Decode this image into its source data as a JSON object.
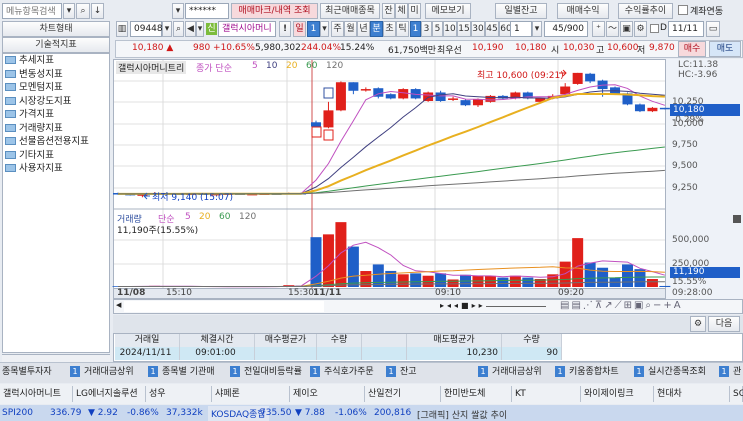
{
  "left": {
    "search_placeholder": "메뉴항목검색",
    "chart_type": "차트형태",
    "tech_indicators": "기술적지표",
    "tree": [
      "추세지표",
      "변동성지표",
      "모멘텀지표",
      "시장강도지표",
      "가격지표",
      "거래량지표",
      "선물옵션전용지표",
      "기타지표",
      "사용자지표"
    ]
  },
  "top": {
    "password": "******",
    "trade_mark_btn": "매매마크/내역 조회",
    "recent_btn": "최근매매종목",
    "jan": "잔",
    "che": "체",
    "mi": "미",
    "memo": "메모보기",
    "daily_balance": "일별잔고",
    "trade_profit": "매매수익",
    "return_trend": "수익률추이",
    "account_link": "계좌연동"
  },
  "chart_toolbar": {
    "code": "094480",
    "new_badge": "신",
    "name": "갤럭시아머니",
    "excl": "!",
    "day": "일",
    "day_n": "1",
    "week": "주",
    "month": "월",
    "year": "년",
    "minute": "분",
    "second": "초",
    "tick": "틱",
    "intervals": [
      "1",
      "3",
      "5",
      "10",
      "15",
      "30",
      "45",
      "60"
    ],
    "custom": "1",
    "count": "45/900",
    "d_label": "D",
    "date": "11/11"
  },
  "quote": {
    "price": "10,180 ▲",
    "change": "980 +10.65%",
    "volume": "5,980,302",
    "vol_ratio": "244.04%",
    "turnover": "15.24%",
    "amount": "61,750백만",
    "best_label": "최우선",
    "ask": "10,190",
    "bid": "10,180",
    "open_label": "시",
    "open": "10,030",
    "high_label": "고",
    "high": "10,600",
    "low_label": "저",
    "low": "9,870",
    "buy": "매수",
    "sell": "매도"
  },
  "colors": {
    "up": "#e0201a",
    "down": "#1f5fc8",
    "ma5": "#c050c0",
    "ma10": "#404080",
    "ma20": "#e8b020",
    "ma60": "#3a9a50",
    "ma120": "#707070"
  },
  "chart_data": {
    "type": "candlestick",
    "legend": {
      "name": "갤럭시아머니트리",
      "label": "종가 단순",
      "periods": [
        "5",
        "10",
        "20",
        "60",
        "120"
      ]
    },
    "vol_legend": {
      "label": "거래량",
      "sub": "단순",
      "periods": [
        "5",
        "20",
        "60",
        "120"
      ],
      "info": "11,190주(15.55%)"
    },
    "high_annot": "최고 10,600 (09:21)",
    "low_annot": "최저 9,140 (15:07)",
    "y_ticks": [
      "10,500",
      "10,250",
      "10,000",
      "9,750",
      "9,500",
      "9,250"
    ],
    "vol_ticks": [
      "500,000",
      "250,000"
    ],
    "lc": "LC:11.38",
    "hc": "HC:-3.96",
    "last": "10,180",
    "last_pct": "-0.29%",
    "vol_last": "11,190",
    "vol_pct": "15.55%",
    "x_labels": [
      "11/08",
      "15:10",
      "15:30",
      "11/11",
      "09:10",
      "09:20"
    ],
    "x_end": "09:28:00",
    "prev_close": 9180,
    "pre": [
      [
        9190,
        9180,
        9195,
        9170,
        8000
      ],
      [
        9180,
        9170,
        9190,
        9160,
        5000
      ],
      [
        9170,
        9175,
        9185,
        9140,
        9000
      ],
      [
        9175,
        9190,
        9200,
        9170,
        12000
      ],
      [
        9190,
        9185,
        9200,
        9175,
        6000
      ],
      [
        9185,
        9180,
        9190,
        9175,
        4000
      ],
      [
        9180,
        9185,
        9190,
        9175,
        4000
      ],
      [
        9185,
        9180,
        9190,
        9175,
        3000
      ],
      [
        9180,
        9180,
        9185,
        9175,
        3000
      ],
      [
        9180,
        9185,
        9190,
        9175,
        3000
      ],
      [
        9185,
        9180,
        9190,
        9175,
        3000
      ],
      [
        9180,
        9180,
        9185,
        9175,
        4000
      ],
      [
        9180,
        9185,
        9190,
        9175,
        5000
      ],
      [
        9185,
        9180,
        9190,
        9175,
        6000
      ],
      [
        9180,
        9190,
        9195,
        9175,
        20000
      ],
      [
        9190,
        9180,
        9195,
        9175,
        15000
      ]
    ],
    "candles": [
      [
        10020,
        9970,
        10040,
        9950,
        530000
      ],
      [
        9960,
        10160,
        10260,
        9950,
        560000
      ],
      [
        10160,
        10490,
        10500,
        10150,
        690000
      ],
      [
        10490,
        10390,
        10490,
        10350,
        430000
      ],
      [
        10410,
        10410,
        10430,
        10380,
        170000
      ],
      [
        10420,
        10320,
        10430,
        10300,
        240000
      ],
      [
        10350,
        10300,
        10360,
        10290,
        171000
      ],
      [
        10300,
        10410,
        10420,
        10290,
        135000
      ],
      [
        10410,
        10300,
        10420,
        10290,
        145000
      ],
      [
        10270,
        10370,
        10380,
        10260,
        120000
      ],
      [
        10370,
        10270,
        10390,
        10260,
        145000
      ],
      [
        10300,
        10300,
        10320,
        10270,
        80000
      ],
      [
        10280,
        10220,
        10290,
        10210,
        130000
      ],
      [
        10220,
        10290,
        10300,
        10200,
        118000
      ],
      [
        10260,
        10330,
        10340,
        10250,
        118000
      ],
      [
        10330,
        10300,
        10340,
        10290,
        100000
      ],
      [
        10300,
        10370,
        10380,
        10290,
        120000
      ],
      [
        10370,
        10300,
        10380,
        10290,
        100000
      ],
      [
        10260,
        10300,
        10310,
        10250,
        85000
      ],
      [
        10300,
        10330,
        10350,
        10290,
        135000
      ],
      [
        10350,
        10440,
        10480,
        10330,
        270000
      ],
      [
        10470,
        10600,
        10600,
        10460,
        520000
      ],
      [
        10590,
        10500,
        10600,
        10480,
        260000
      ],
      [
        10510,
        10410,
        10520,
        10320,
        205000
      ],
      [
        10430,
        10350,
        10440,
        10340,
        100000
      ],
      [
        10360,
        10230,
        10370,
        10220,
        240000
      ],
      [
        10230,
        10150,
        10240,
        10140,
        190000
      ],
      [
        10150,
        10190,
        10200,
        10140,
        85000
      ],
      [
        10190,
        10180,
        10190,
        10170,
        11190
      ]
    ]
  },
  "bottom": {
    "gear": "⚙",
    "next": "다음",
    "table": {
      "headers": [
        "거래일",
        "체결시간",
        "매수평균가",
        "수량",
        "",
        "매도평균가",
        "수량"
      ],
      "row": [
        "2024/11/11",
        "09:01:00",
        "",
        "",
        "",
        "10,230",
        "90"
      ]
    },
    "tasks": [
      "종목별투자자",
      "거래대금상위",
      "종목별 기관매",
      "전일대비등락률",
      "주식호가주문",
      "잔고",
      "거래대금상위",
      "키움종합차트",
      "실시간종목조회",
      "관"
    ],
    "task_badge": "1",
    "stocks": [
      "갤럭시아머니트",
      "LG에너지솔루션",
      "성우",
      "샤페론",
      "제이오",
      "산일전기",
      "한미반도체",
      "KT",
      "와이제이링크",
      "현대차",
      "SG"
    ],
    "index": {
      "k200": "SPI200",
      "k200_val": "336.79",
      "k200_chg": "▼ 2.92",
      "k200_pct": "-0.86%",
      "k200_vol": "37,332k",
      "kq": "KOSDAQ종합",
      "kq_val": "735.50",
      "kq_chg": "▼ 7.88",
      "kq_pct": "-1.06%",
      "kq_vol": "200,816",
      "news": "[그래픽] 산지 쌀값 추이"
    }
  }
}
